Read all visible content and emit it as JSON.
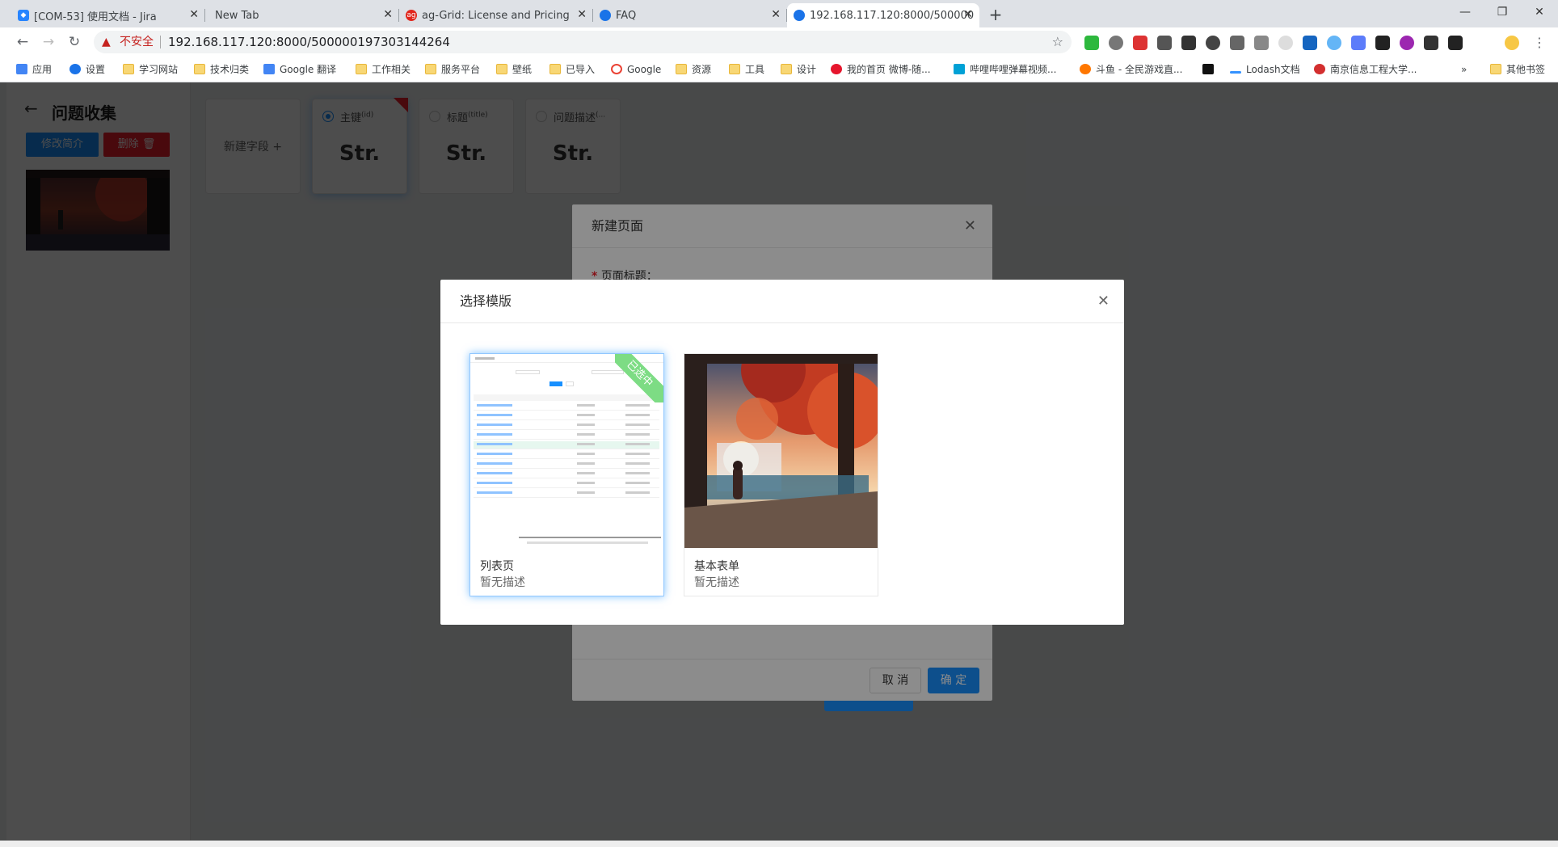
{
  "browser": {
    "tabs": [
      {
        "title": "[COM-53] 使用文档 - Jira",
        "icon": "jira-icon",
        "color": "#2684ff"
      },
      {
        "title": "New Tab",
        "icon": "",
        "color": ""
      },
      {
        "title": "ag-Grid: License and Pricing",
        "icon": "ag-grid-icon",
        "color": "#e1261c"
      },
      {
        "title": "FAQ",
        "icon": "globe-icon",
        "color": "#1a73e8"
      },
      {
        "title": "192.168.117.120:8000/500000",
        "icon": "globe-icon",
        "color": "#1a73e8"
      }
    ],
    "new_tab_symbol": "+",
    "window_controls": [
      "—",
      "❐",
      "✕"
    ],
    "nav": {
      "back": "←",
      "forward": "→",
      "reload": "↻"
    },
    "omnibox": {
      "warning": "▲",
      "insecure_label": "不安全",
      "url": "192.168.117.120:8000/500000197303144264",
      "star": "☆"
    },
    "bookmarks": [
      {
        "label": "应用",
        "icon": "apps-grid-icon"
      },
      {
        "label": "设置",
        "icon": "gear-icon"
      },
      {
        "label": "学习网站",
        "icon": "folder-icon"
      },
      {
        "label": "技术归类",
        "icon": "folder-icon"
      },
      {
        "label": "Google 翻译",
        "icon": "google-translate-icon"
      },
      {
        "label": "工作相关",
        "icon": "folder-icon"
      },
      {
        "label": "服务平台",
        "icon": "folder-icon"
      },
      {
        "label": "壁纸",
        "icon": "folder-icon"
      },
      {
        "label": "已导入",
        "icon": "folder-icon"
      },
      {
        "label": "Google",
        "icon": "google-icon"
      },
      {
        "label": "资源",
        "icon": "folder-icon"
      },
      {
        "label": "工具",
        "icon": "folder-icon"
      },
      {
        "label": "设计",
        "icon": "folder-icon"
      },
      {
        "label": "我的首页 微博-随...",
        "icon": "weibo-icon"
      },
      {
        "label": "哔哩哔哩弹幕视频...",
        "icon": "bilibili-icon"
      },
      {
        "label": "斗鱼 - 全民游戏直...",
        "icon": "douyu-icon"
      },
      {
        "label": "",
        "icon": "zhihu-z-icon"
      },
      {
        "label": "Lodash文档",
        "icon": "lodash-icon"
      },
      {
        "label": "南京信息工程大学...",
        "icon": "university-icon"
      }
    ],
    "bookmarks_overflow": "»",
    "other_bookmarks": "其他书签"
  },
  "app": {
    "back_arrow": "←",
    "title": "问题收集",
    "edit_intro_button": "修改简介",
    "delete_button": "删除",
    "delete_icon": "🗑",
    "new_field_label": "新建字段 +",
    "fields": [
      {
        "label": "主键",
        "key": "(id)",
        "type": "Str.",
        "selected": true
      },
      {
        "label": "标题",
        "key": "(title)",
        "type": "Str.",
        "selected": false
      },
      {
        "label": "问题描述",
        "key": "(...",
        "type": "Str.",
        "selected": false
      }
    ]
  },
  "new_page_dialog": {
    "title": "新建页面",
    "close": "✕",
    "page_title_label": "页面标题：",
    "required_mark": "*",
    "cancel_button": "取 消",
    "ok_button": "确 定"
  },
  "template_dialog": {
    "title": "选择模版",
    "close": "✕",
    "selected_badge": "已选中",
    "templates": [
      {
        "name": "列表页",
        "description": "暂无描述",
        "selected": true
      },
      {
        "name": "基本表单",
        "description": "暂无描述",
        "selected": false
      }
    ]
  },
  "colors": {
    "primary": "#1890ff",
    "danger": "#f5222d",
    "selected_badge": "#7ddc84"
  }
}
